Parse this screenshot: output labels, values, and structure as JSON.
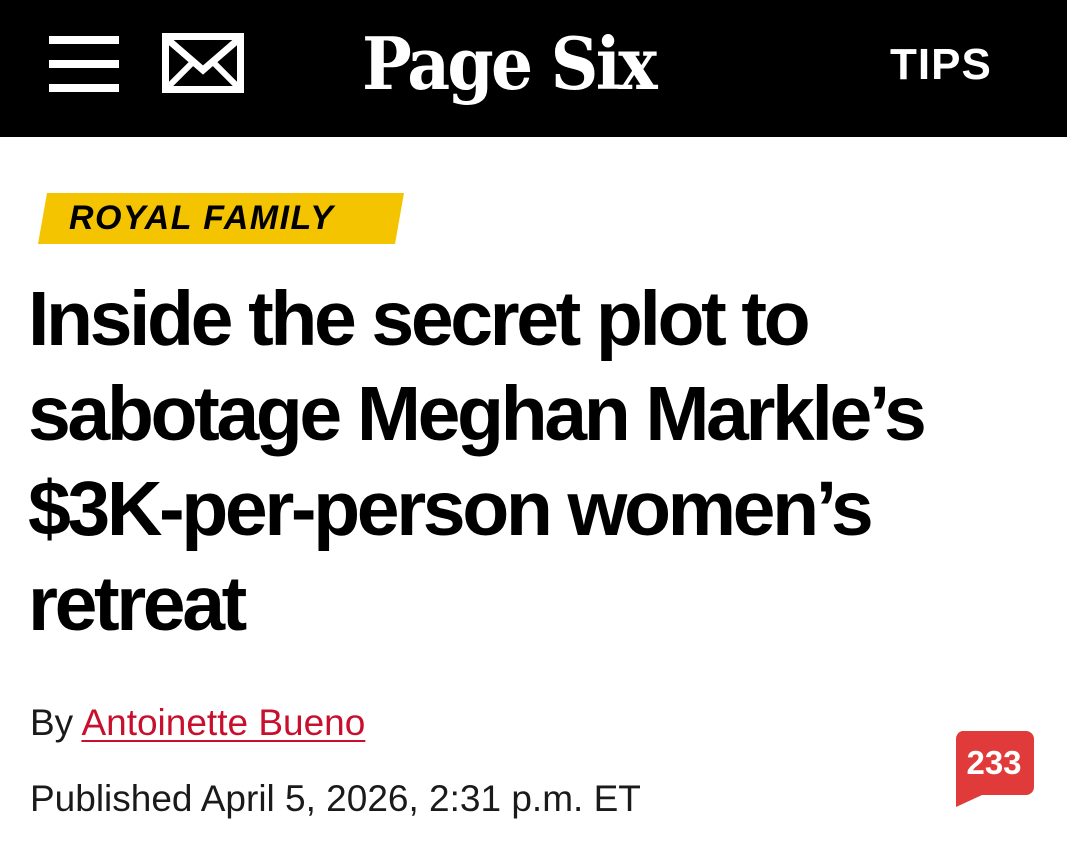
{
  "header": {
    "logo": "Page Six",
    "tips_label": "TIPS",
    "menu_icon": "hamburger-menu-icon",
    "mail_icon": "envelope-icon",
    "background_color": "#000000"
  },
  "article": {
    "category": "ROYAL FAMILY",
    "category_color": "#f5c400",
    "headline": "Inside the secret plot to sabotage Meghan Markle’s $3K-per-person women’s retreat",
    "byline_prefix": "By",
    "author": "Antoinette Bueno",
    "author_link_color": "#c8102e",
    "published": "Published April 5, 2026, 2:31 p.m. ET",
    "comment_count": "233",
    "comment_badge_color": "#e03a3a",
    "comment_icon": "speech-bubble-icon"
  }
}
